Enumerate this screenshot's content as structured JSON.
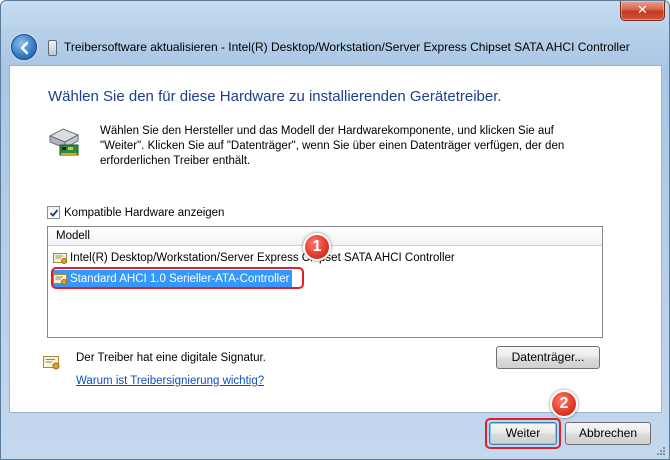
{
  "window": {
    "close_glyph": "✕",
    "nav_title": "Treibersoftware aktualisieren - Intel(R) Desktop/Workstation/Server Express Chipset SATA AHCI Controller"
  },
  "main": {
    "heading": "Wählen Sie den für diese Hardware zu installierenden Gerätetreiber.",
    "intro": "Wählen Sie den Hersteller und das Modell der Hardwarekomponente, und klicken Sie auf \"Weiter\". Klicken Sie auf \"Datenträger\", wenn Sie über einen Datenträger verfügen, der den erforderlichen Treiber enthält.",
    "compatible_checkbox": {
      "label": "Kompatible Hardware anzeigen",
      "checked": true
    },
    "model_list": {
      "header": "Modell",
      "items": [
        {
          "label": "Intel(R) Desktop/Workstation/Server Express Chipset SATA AHCI Controller",
          "selected": false
        },
        {
          "label": "Standard AHCI 1.0 Serieller-ATA-Controller",
          "selected": true
        }
      ]
    },
    "signature": {
      "text": "Der Treiber hat eine digitale Signatur.",
      "link": "Warum ist Treibersignierung wichtig?"
    },
    "disk_button": "Datenträger..."
  },
  "footer": {
    "next_button": "Weiter",
    "cancel_button": "Abbrechen"
  },
  "annotations": {
    "badge_1": "1",
    "badge_2": "2",
    "highlight_color": "#d8232a"
  },
  "colors": {
    "heading": "#1e3d8f",
    "selection": "#3399ff",
    "link": "#0b4fbf"
  },
  "icons": {
    "back": "back-arrow-icon",
    "hardware": "hardware-card-icon",
    "certificate": "certificate-icon",
    "close": "close-icon"
  }
}
